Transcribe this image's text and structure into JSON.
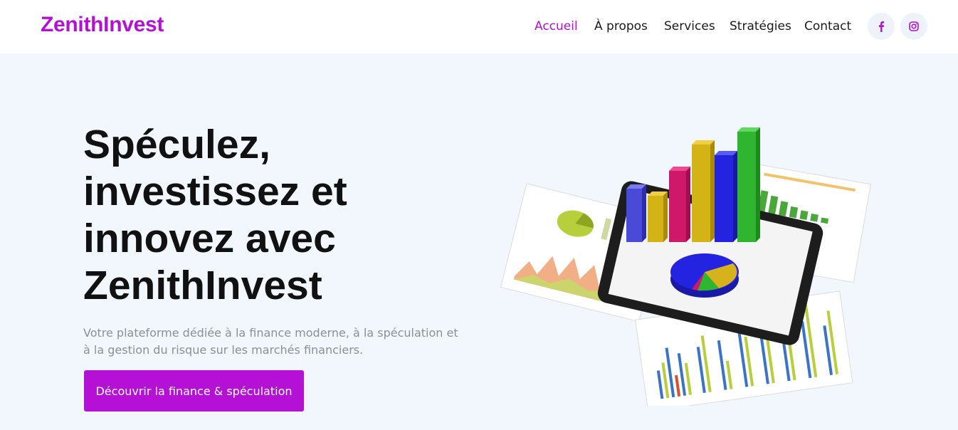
{
  "brand": {
    "name": "ZenithInvest",
    "color": "#b510d6"
  },
  "nav": {
    "items": [
      {
        "label": "Accueil",
        "active": true
      },
      {
        "label": "À propos",
        "active": false
      },
      {
        "label": "Services",
        "active": false
      },
      {
        "label": "Stratégies",
        "active": false
      },
      {
        "label": "Contact",
        "active": false
      }
    ]
  },
  "social": [
    {
      "icon": "facebook-icon"
    },
    {
      "icon": "instagram-icon"
    }
  ],
  "hero": {
    "headline_lines": [
      "Spéculez,",
      "investissez et",
      "innovez avec",
      "ZenithInvest"
    ],
    "subtitle": "Votre plateforme dédiée à la finance moderne, à la spéculation et à la gestion du risque sur les marchés financiers.",
    "cta_label": "Découvrir la finance & spéculation",
    "illustration": "financial-charts-illustration"
  },
  "colors": {
    "accent": "#b510d6",
    "hero_bg": "#f2f6fd",
    "text_dark": "#111111",
    "text_muted": "#8a8f99"
  }
}
